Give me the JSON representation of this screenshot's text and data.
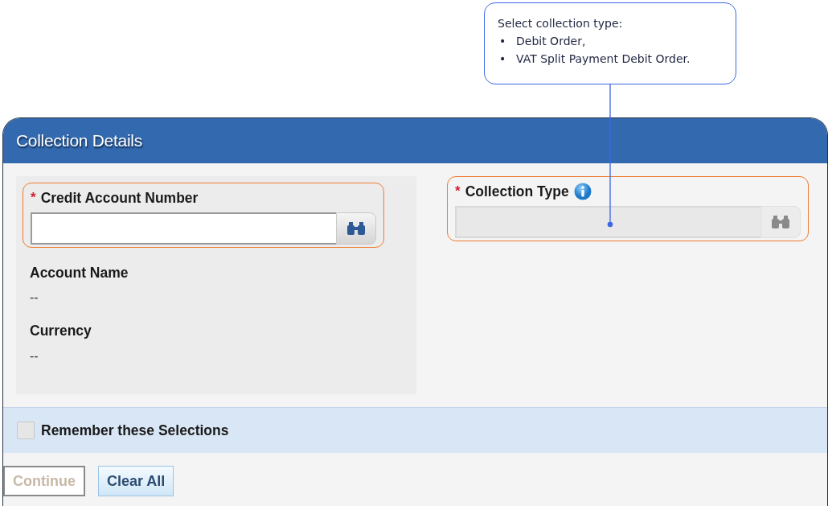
{
  "callout": {
    "heading": "Select collection type:",
    "items": [
      {
        "bullet": "•",
        "text": "Debit Order,"
      },
      {
        "bullet": "•",
        "text": "VAT Split Payment Debit Order."
      }
    ]
  },
  "panel": {
    "title": "Collection Details",
    "lookups": [
      {
        "label": "Credit Account Number",
        "required": "*",
        "info": false,
        "disabled": false,
        "highlighted": true
      },
      {
        "label": "Collection Type",
        "required": "*",
        "info": true,
        "disabled": true,
        "highlighted": true
      }
    ],
    "details": [
      {
        "label": "Account Name",
        "value": "--"
      },
      {
        "label": "Currency",
        "value": "--"
      }
    ],
    "remember": {
      "label": "Remember these Selections",
      "checked": false
    },
    "buttons": [
      {
        "label": "Continue",
        "disabled": true
      },
      {
        "label": "Clear All",
        "disabled": false
      }
    ]
  }
}
